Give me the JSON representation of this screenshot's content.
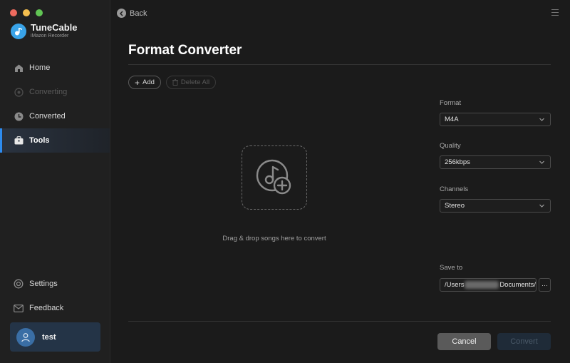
{
  "window": {
    "traffic_lights": [
      "close",
      "minimize",
      "zoom"
    ]
  },
  "brand": {
    "name": "TuneCable",
    "subtitle": "iMazon Recorder",
    "logo_color": "#39a3e8"
  },
  "sidebar": {
    "items": [
      {
        "label": "Home",
        "icon": "home-icon",
        "state": "normal"
      },
      {
        "label": "Converting",
        "icon": "converting-icon",
        "state": "disabled"
      },
      {
        "label": "Converted",
        "icon": "clock-icon",
        "state": "normal"
      },
      {
        "label": "Tools",
        "icon": "toolbox-icon",
        "state": "active"
      }
    ],
    "bottom_items": [
      {
        "label": "Settings",
        "icon": "gear-icon"
      },
      {
        "label": "Feedback",
        "icon": "mail-icon"
      }
    ],
    "user": {
      "name": "test",
      "icon": "user-icon"
    },
    "accent": "#2d8cf0"
  },
  "header": {
    "back_label": "Back",
    "menu_icon": "hamburger-icon"
  },
  "main": {
    "title": "Format Converter",
    "toolbar": {
      "add_label": "Add",
      "delete_all_label": "Delete All"
    },
    "dropzone_text": "Drag & drop songs here to convert"
  },
  "settings": {
    "format": {
      "label": "Format",
      "value": "M4A"
    },
    "quality": {
      "label": "Quality",
      "value": "256kbps"
    },
    "channels": {
      "label": "Channels",
      "value": "Stereo"
    },
    "save_to": {
      "label": "Save to",
      "path_start": "/Users",
      "path_end": "Documents/",
      "browse_label": "···"
    }
  },
  "footer": {
    "cancel_label": "Cancel",
    "convert_label": "Convert"
  }
}
